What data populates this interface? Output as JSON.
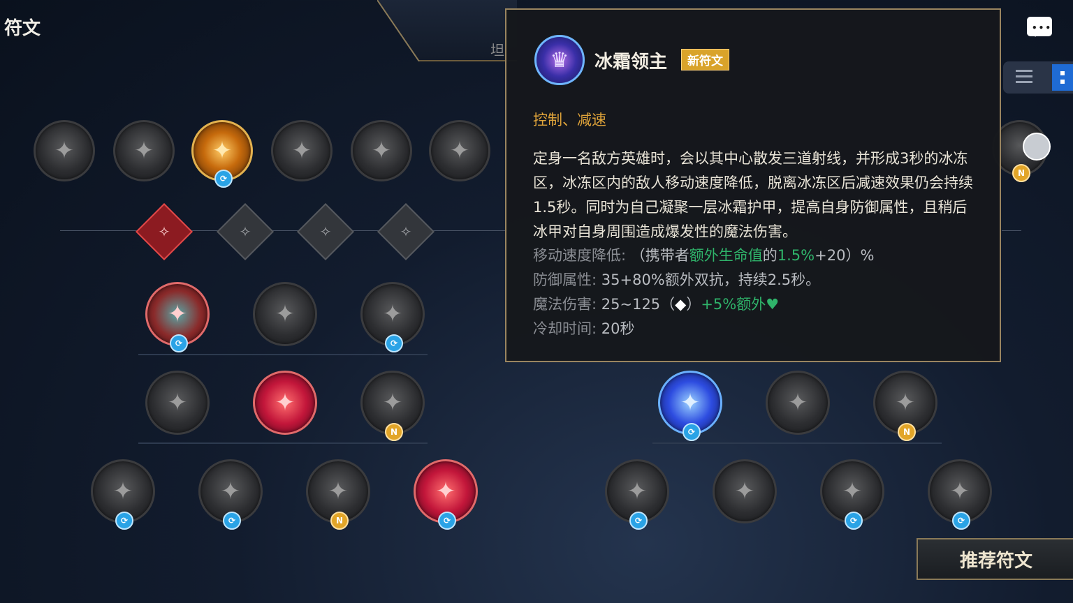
{
  "header": {
    "title": "符文",
    "tab_label": "坦"
  },
  "colors": {
    "accent_gold": "#e0a43a",
    "bonus_green": "#2fb36a",
    "border_gold": "#9a8560"
  },
  "primary_tree": {
    "keystone_row": [
      {
        "icon": "claw-icon",
        "badge": ""
      },
      {
        "icon": "hooded-figure-icon",
        "badge": ""
      },
      {
        "icon": "sun-wheel-icon",
        "badge": "refresh",
        "selected": true
      },
      {
        "icon": "spear-icon",
        "badge": ""
      },
      {
        "icon": "wing-icon",
        "badge": ""
      },
      {
        "icon": "halberd-icon",
        "badge": ""
      }
    ],
    "category_diamonds": [
      {
        "icon": "crown-icon",
        "active": true
      },
      {
        "icon": "burst-icon",
        "active": false
      },
      {
        "icon": "fortress-icon",
        "active": false
      },
      {
        "icon": "sparkle-icon",
        "active": false
      }
    ],
    "row1": [
      {
        "icon": "armored-warrior-icon",
        "badge": "refresh",
        "selected": true
      },
      {
        "icon": "crescent-icon",
        "badge": ""
      },
      {
        "icon": "sword-icon",
        "badge": "refresh"
      }
    ],
    "row2": [
      {
        "icon": "slash-icon",
        "badge": ""
      },
      {
        "icon": "blood-claw-icon",
        "badge": "",
        "selected": true
      },
      {
        "icon": "flame-hand-icon",
        "badge": "N"
      }
    ],
    "row3": [
      {
        "icon": "eye-card-icon",
        "badge": "refresh"
      },
      {
        "icon": "owl-icon",
        "badge": "refresh"
      },
      {
        "icon": "fist-icon",
        "badge": "N"
      },
      {
        "icon": "red-hood-icon",
        "badge": "refresh",
        "selected": true
      }
    ]
  },
  "secondary_tree": {
    "row2": [
      {
        "icon": "cosmic-mask-icon",
        "badge": "refresh",
        "selected": true
      },
      {
        "icon": "scorpion-icon",
        "badge": ""
      },
      {
        "icon": "spiked-orb-icon",
        "badge": "N"
      }
    ],
    "row3": [
      {
        "icon": "wind-icon",
        "badge": "refresh"
      },
      {
        "icon": "shadow-icon",
        "badge": ""
      },
      {
        "icon": "vortex-icon",
        "badge": "refresh"
      },
      {
        "icon": "mirror-icon",
        "badge": "refresh"
      }
    ],
    "side_badge": "N"
  },
  "badge_labels": {
    "refresh": "⟳",
    "N": "N"
  },
  "tooltip": {
    "name": "冰霜领主",
    "tag": "新符文",
    "category": "控制、减速",
    "description": "定身一名敌方英雄时，会以其中心散发三道射线，并形成3秒的冰冻区，冰冻区内的敌人移动速度降低，脱离冰冻区后减速效果仍会持续1.5秒。同时为自己凝聚一层冰霜护甲，提高自身防御属性，且稍后冰甲对自身周围造成爆发性的魔法伤害。",
    "stats": {
      "slow": {
        "label": "移动速度降低:",
        "prefix": "（携带者",
        "green1": "额外生命值",
        "mid": "的",
        "green2": "1.5%",
        "suffix": "+20）%"
      },
      "defense": {
        "label": "防御属性:",
        "value": "35+80%额外双抗，持续2.5秒。"
      },
      "magic": {
        "label": "魔法伤害:",
        "value": "25~125（",
        "icon": "◆",
        "close": "）",
        "green": "+5%额外",
        "heart": "♥"
      },
      "cooldown": {
        "label": "冷却时间:",
        "value": "20秒"
      }
    }
  },
  "recommend_button": "推荐符文"
}
